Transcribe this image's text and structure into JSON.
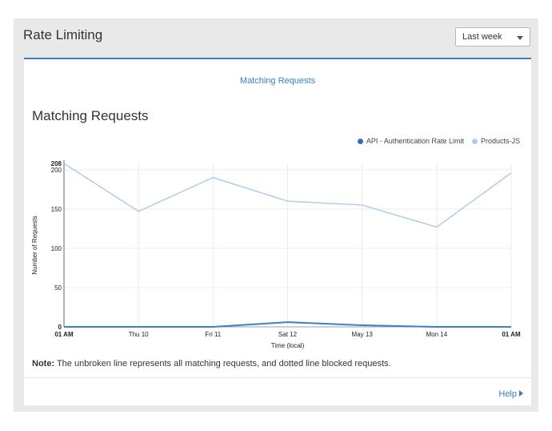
{
  "card": {
    "title": "Rate Limiting"
  },
  "range_select": {
    "value": "Last week"
  },
  "panel": {
    "tab_label": "Matching Requests",
    "help_label": "Help"
  },
  "note": {
    "bold": "Note:",
    "text": " The unbroken line represents all matching requests, and dotted line blocked requests."
  },
  "colors": {
    "accent": "#3b7dc3",
    "series_api": "#3f80c5",
    "series_products": "#adc9ec"
  },
  "chart_data": {
    "type": "line",
    "title": "Matching Requests",
    "xlabel": "Time (local)",
    "ylabel": "Number of Requests",
    "x_tick_labels": [
      "01 AM",
      "Thu 10",
      "Fri 11",
      "Sat 12",
      "May 13",
      "Mon 14",
      "01 AM"
    ],
    "y_ticks": [
      0,
      50,
      100,
      150,
      200
    ],
    "y_max_label": 208,
    "ylim": [
      0,
      208
    ],
    "grid": true,
    "legend_position": "top-right",
    "series": [
      {
        "name": "API - Authentication Rate Limit",
        "color": "#3f80c5",
        "style": "solid",
        "values": [
          0,
          0,
          0,
          6,
          2,
          0,
          0
        ]
      },
      {
        "name": "API - Authentication Rate Limit",
        "color": "#9dbde3",
        "style": "dotted",
        "values": [
          0,
          0,
          0,
          0,
          0,
          0,
          0
        ]
      },
      {
        "name": "Products-JS",
        "color": "#adc9ec",
        "style": "solid",
        "values": [
          208,
          147,
          190,
          160,
          155,
          127,
          196
        ]
      }
    ]
  }
}
